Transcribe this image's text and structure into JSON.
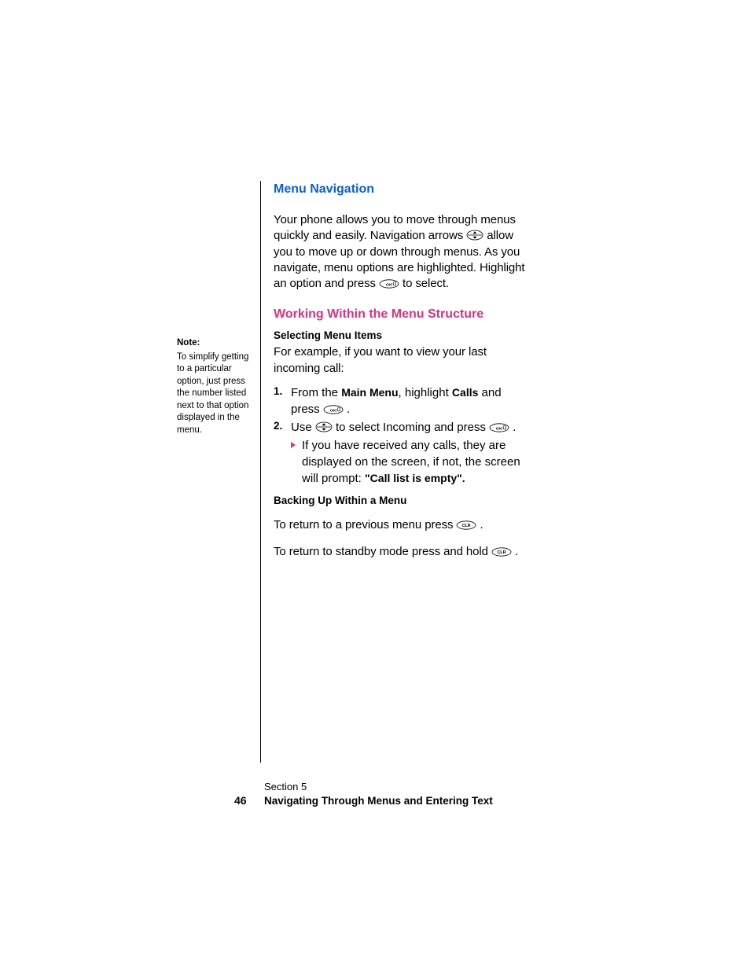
{
  "sidebar": {
    "noteTitle": "Note:",
    "noteBody": "To simplify getting to a particular option, just press the number listed next to that option displayed in the menu."
  },
  "headings": {
    "h1": "Menu Navigation",
    "h2": "Working Within the Menu Structure",
    "sub1": "Selecting Menu Items",
    "sub2": "Backing Up Within a Menu"
  },
  "intro": {
    "p1a": "Your phone allows you to move through menus quickly and easily. Navigation arrows ",
    "p1b": " allow you to move up or down through menus. As you navigate, menu options are highlighted. Highlight an option and press ",
    "p1c": " to select."
  },
  "example": {
    "lead": "For example, if you want to view your last incoming call:"
  },
  "steps": {
    "n1": "1.",
    "n2": "2.",
    "s1a": "From the ",
    "s1b": "Main Menu",
    "s1c": ", highlight ",
    "s1d": "Calls",
    "s1e": " and press ",
    "s1f": " .",
    "s2a": "Use ",
    "s2b": " to select Incoming and press ",
    "s2c": " .",
    "bulletA": "If you have received any calls, they are displayed on the screen, if not, the screen will prompt: ",
    "bulletB": "\"Call list is empty\"."
  },
  "back": {
    "p1a": "To return to a previous menu press ",
    "p1b": " .",
    "p2a": "To return to standby mode press and hold ",
    "p2b": " ."
  },
  "footer": {
    "section": "Section 5",
    "page": "46",
    "title": "Navigating Through Menus and Entering Text"
  },
  "icons": {
    "nav": "nav-key",
    "ok": "ok-key",
    "clr": "clr-key"
  }
}
